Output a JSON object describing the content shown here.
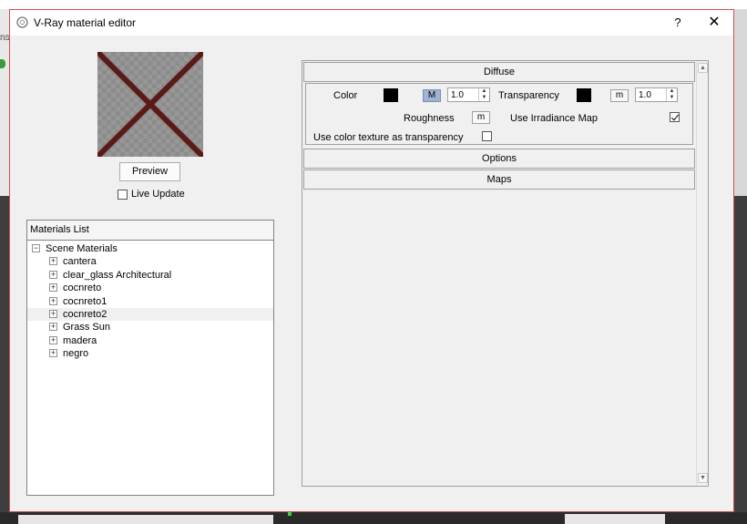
{
  "window": {
    "title": "V-Ray material editor",
    "help_label": "?",
    "close_label": "✕"
  },
  "background": {
    "left_text": "ns"
  },
  "preview": {
    "button_label": "Preview",
    "live_update_label": "Live Update",
    "live_update_checked": false
  },
  "materials": {
    "header": "Materials List",
    "root": "Scene Materials",
    "items": [
      "cantera",
      "clear_glass Architectural",
      "cocnreto",
      "cocnreto1",
      "cocnreto2",
      "Grass Sun",
      "madera",
      "negro"
    ],
    "selected_index": 4
  },
  "diffuse": {
    "header": "Diffuse",
    "color_label": "Color",
    "color_value": "#000000",
    "color_map_label": "M",
    "color_amount": "1.0",
    "transparency_label": "Transparency",
    "transparency_value": "#000000",
    "transparency_map_label": "m",
    "transparency_amount": "1.0",
    "roughness_label": "Roughness",
    "roughness_map_label": "m",
    "irradiance_label": "Use Irradiance Map",
    "irradiance_checked": true,
    "color_texture_label": "Use color texture as transparency",
    "color_texture_checked": false
  },
  "options": {
    "header": "Options"
  },
  "maps": {
    "header": "Maps"
  }
}
